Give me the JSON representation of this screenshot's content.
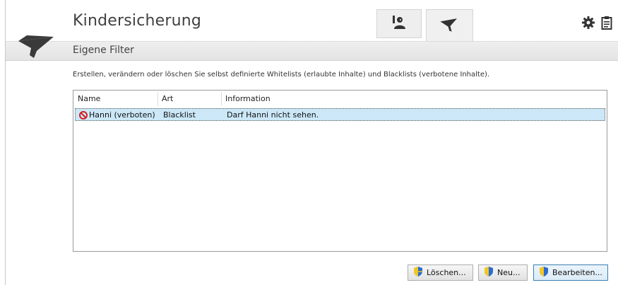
{
  "app": {
    "title": "Kindersicherung"
  },
  "tabs": [
    {
      "name": "user-tab",
      "icon": "user-icon",
      "active": false
    },
    {
      "name": "filter-tab",
      "icon": "filter-icon",
      "active": true
    }
  ],
  "top_icons": [
    "gear-icon",
    "clipboard-icon"
  ],
  "section": {
    "title": "Eigene Filter"
  },
  "description": "Erstellen, verändern oder löschen Sie selbst definierte Whitelists (erlaubte Inhalte) und Blacklists (verbotene Inhalte).",
  "table": {
    "columns": [
      "Name",
      "Art",
      "Information"
    ],
    "rows": [
      {
        "icon": "blocked-icon",
        "name": "Hanni (verboten)",
        "art": "Blacklist",
        "information": "Darf Hanni nicht sehen.",
        "selected": true
      }
    ]
  },
  "buttons": {
    "delete": "Löschen...",
    "new": "Neu...",
    "edit": "Bearbeiten..."
  },
  "colors": {
    "accent_icon": "#3c3c3c",
    "selection": "#cce8f8",
    "block_red": "#d42020",
    "shield_blue": "#2a6bd1",
    "shield_yellow": "#f3c623"
  }
}
